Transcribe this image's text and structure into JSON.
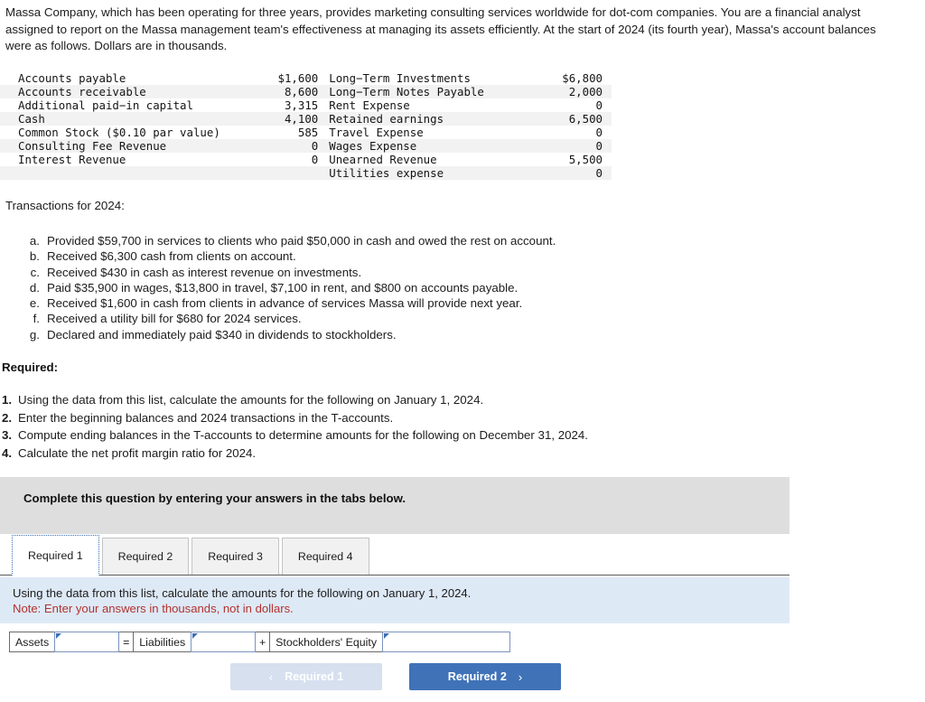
{
  "intro": "Massa Company, which has been operating for three years, provides marketing consulting services worldwide for dot-com companies. You are a financial analyst assigned to report on the Massa management team's effectiveness at managing its assets efficiently. At the start of 2024 (its fourth year), Massa's account balances were as follows. Dollars are in thousands.",
  "balances": {
    "rows": [
      {
        "left_name": "Accounts payable",
        "left_value": "$1,600",
        "right_name": "Long−Term Investments",
        "right_value": "$6,800"
      },
      {
        "left_name": "Accounts receivable",
        "left_value": "8,600",
        "right_name": "Long−Term Notes Payable",
        "right_value": "2,000"
      },
      {
        "left_name": "Additional paid−in capital",
        "left_value": "3,315",
        "right_name": "Rent Expense",
        "right_value": "0"
      },
      {
        "left_name": "Cash",
        "left_value": "4,100",
        "right_name": "Retained earnings",
        "right_value": "6,500"
      },
      {
        "left_name": "Common Stock ($0.10 par value)",
        "left_value": "585",
        "right_name": "Travel Expense",
        "right_value": "0"
      },
      {
        "left_name": "Consulting Fee Revenue",
        "left_value": "0",
        "right_name": "Wages Expense",
        "right_value": "0"
      },
      {
        "left_name": "Interest Revenue",
        "left_value": "0",
        "right_name": "Unearned Revenue",
        "right_value": "5,500"
      },
      {
        "left_name": "",
        "left_value": "",
        "right_name": "Utilities expense",
        "right_value": "0"
      }
    ]
  },
  "transactions": {
    "heading": "Transactions for 2024:",
    "items": [
      {
        "marker": "a.",
        "text": "Provided $59,700 in services to clients who paid $50,000 in cash and owed the rest on account."
      },
      {
        "marker": "b.",
        "text": "Received $6,300 cash from clients on account."
      },
      {
        "marker": "c.",
        "text": "Received $430 in cash as interest revenue on investments."
      },
      {
        "marker": "d.",
        "text": "Paid $35,900 in wages, $13,800 in travel, $7,100 in rent, and $800 on accounts payable."
      },
      {
        "marker": "e.",
        "text": "Received $1,600 in cash from clients in advance of services Massa will provide next year."
      },
      {
        "marker": "f.",
        "text": "Received a utility bill for $680 for 2024 services."
      },
      {
        "marker": "g.",
        "text": "Declared and immediately paid $340 in dividends to stockholders."
      }
    ]
  },
  "required": {
    "heading": "Required:",
    "items": [
      {
        "marker": "1.",
        "text": "Using the data from this list, calculate the amounts for the following on January 1, 2024."
      },
      {
        "marker": "2.",
        "text": "Enter the beginning balances and 2024 transactions in the T-accounts."
      },
      {
        "marker": "3.",
        "text": "Compute ending balances in the T-accounts to determine amounts for the following on December 31, 2024."
      },
      {
        "marker": "4.",
        "text": "Calculate the net profit margin ratio for 2024."
      }
    ]
  },
  "complete_bar": {
    "text": "Complete this question by entering your answers in the tabs below."
  },
  "tabs": [
    {
      "label": "Required 1",
      "active": true
    },
    {
      "label": "Required 2",
      "active": false
    },
    {
      "label": "Required 3",
      "active": false
    },
    {
      "label": "Required 4",
      "active": false
    }
  ],
  "note_panel": {
    "line1": "Using the data from this list, calculate the amounts for the following on January 1, 2024.",
    "line2": "Note: Enter your answers in thousands, not in dollars."
  },
  "equation": {
    "assets_label": "Assets",
    "assets_value": "",
    "operator_equals": "=",
    "liabilities_label": "Liabilities",
    "liabilities_value": "",
    "operator_plus": "+",
    "equity_label": "Stockholders' Equity",
    "equity_value": ""
  },
  "nav": {
    "prev_label": "Required 1",
    "prev_chevron": "‹",
    "next_label": "Required 2",
    "next_chevron": "›"
  },
  "colors": {
    "accent_blue": "#4072b8",
    "disabled_blue": "#d6e0ef",
    "note_panel_bg": "#dee9f6",
    "note_red": "#b3322e",
    "grey_bar": "#dededf",
    "table_alt_row": "#f2f2f2"
  }
}
